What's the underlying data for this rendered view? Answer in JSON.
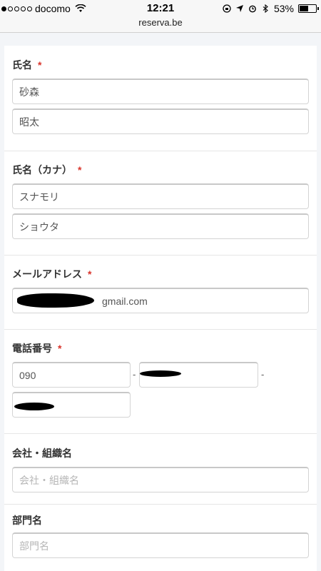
{
  "status_bar": {
    "carrier": "docomo",
    "time": "12:21",
    "battery": "53%",
    "battery_level": 0.53
  },
  "url_bar": {
    "url": "reserva.be"
  },
  "form": {
    "name": {
      "label": "氏名",
      "required_mark": "*",
      "last_name": "砂森",
      "first_name": "昭太"
    },
    "kana": {
      "label": "氏名（カナ）",
      "required_mark": "*",
      "last_name": "スナモリ",
      "first_name": "ショウタ"
    },
    "email": {
      "label": "メールアドレス",
      "required_mark": "*",
      "value_visible": "gmail.com"
    },
    "phone": {
      "label": "電話番号",
      "required_mark": "*",
      "part1": "090",
      "separator": "-"
    },
    "company": {
      "label": "会社・組織名",
      "placeholder": "会社・組織名"
    },
    "department": {
      "label": "部門名",
      "placeholder": "部門名"
    }
  }
}
